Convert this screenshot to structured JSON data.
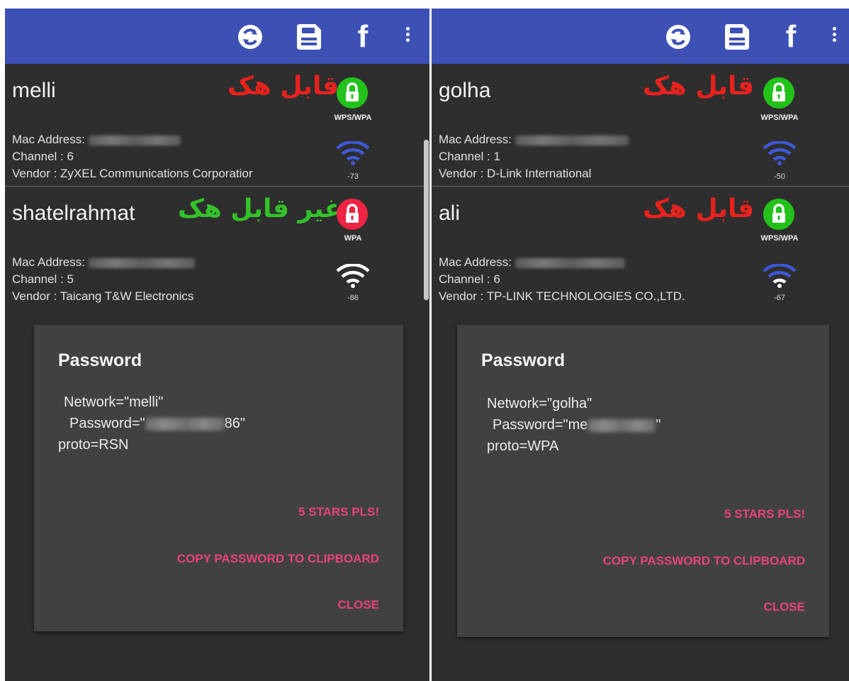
{
  "colors": {
    "appbar": "#3d51b5",
    "background": "#2e2e2e",
    "dialog": "#414141",
    "accent_pink": "#e9437a",
    "hackable_red": "#e8221d",
    "not_hackable_green": "#34c22a",
    "lock_green": "#22c21a",
    "lock_red": "#ee2442",
    "wifi_blue": "#3f58d8",
    "wifi_white": "#ffffff"
  },
  "toolbar": {
    "icons": [
      "sync-icon",
      "save-icon",
      "facebook-icon",
      "overflow-menu-icon"
    ],
    "facebook_glyph": "f"
  },
  "left": {
    "networks": [
      {
        "ssid": "melli",
        "hack_label": "قابل هک",
        "security": "WPS/WPA",
        "mac_label": "Mac Address:",
        "channel": "Channel : 6",
        "vendor": "Vendor : ZyXEL Communications Corporatior",
        "signal": "-73"
      },
      {
        "ssid": "shatelrahmat",
        "hack_label": "غیر قابل هک",
        "security": "WPA",
        "mac_label": "Mac Address:",
        "channel": "Channel : 5",
        "vendor": "Vendor : Taicang T&W Electronics",
        "signal": "-86"
      }
    ],
    "dialog": {
      "title": "Password",
      "network_line": "Network=\"melli\"",
      "password_prefix": "Password=\"",
      "password_suffix": "86\"",
      "proto_line": "proto=RSN",
      "buttons": [
        "5 STARS PLS!",
        "COPY PASSWORD TO CLIPBOARD",
        "CLOSE"
      ]
    }
  },
  "right": {
    "networks": [
      {
        "ssid": "golha",
        "hack_label": "قابل هک",
        "security": "WPS/WPA",
        "mac_label": "Mac Address:",
        "channel": "Channel : 1",
        "vendor": "Vendor : D-Link International",
        "signal": "-50"
      },
      {
        "ssid": "ali",
        "hack_label": "قابل هک",
        "security": "WPS/WPA",
        "mac_label": "Mac Address:",
        "channel": "Channel : 6",
        "vendor": "Vendor : TP-LINK TECHNOLOGIES CO.,LTD.",
        "signal": "-67"
      }
    ],
    "dialog": {
      "title": "Password",
      "network_line": "Network=\"golha\"",
      "password_prefix": "Password=\"me",
      "password_suffix": "\"",
      "proto_line": "proto=WPA",
      "buttons": [
        "5 STARS PLS!",
        "COPY PASSWORD TO CLIPBOARD",
        "CLOSE"
      ]
    }
  }
}
